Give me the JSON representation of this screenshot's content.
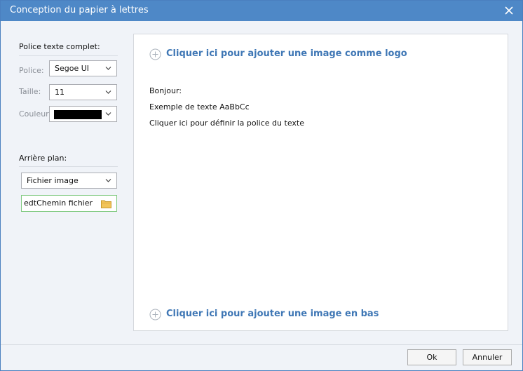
{
  "window": {
    "title": "Conception du papier à lettres"
  },
  "sidebar": {
    "font_section": {
      "title": "Police texte complet:"
    },
    "police": {
      "label": "Police:",
      "value": "Segoe UI"
    },
    "taille": {
      "label": "Taille:",
      "value": "11"
    },
    "couleur": {
      "label": "Couleur:",
      "value_color": "#000000"
    },
    "background_section": {
      "title": "Arrière plan:"
    },
    "background_type": {
      "value": "Fichier image"
    },
    "file_path": {
      "value": "edtChemin fichier"
    }
  },
  "main": {
    "add_logo": "Cliquer ici pour ajouter une image comme logo",
    "lines": [
      "Bonjour:",
      "Exemple de texte  AaBbCc",
      "Cliquer ici pour définir la police du texte"
    ],
    "add_bottom": "Cliquer ici pour ajouter une image en bas"
  },
  "footer": {
    "ok_label": "Ok",
    "cancel_label": "Annuler"
  },
  "colors": {
    "titlebar": "#4e88c7",
    "link": "#3f77b5",
    "path_border": "#7fc97f"
  }
}
